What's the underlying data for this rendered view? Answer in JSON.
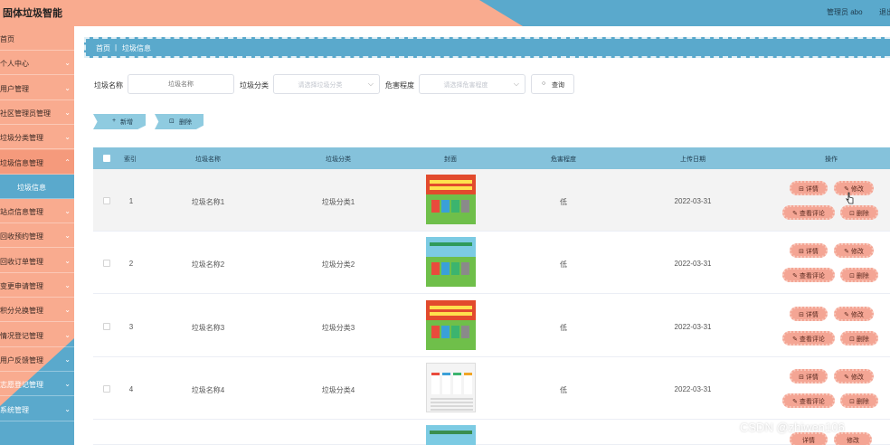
{
  "header": {
    "title": "固体垃圾智能",
    "user": "管理员 abo",
    "logout": "退出"
  },
  "sidebar": {
    "items": [
      {
        "label": "首页",
        "chevron": false
      },
      {
        "label": "个人中心",
        "chevron": true
      },
      {
        "label": "用户管理",
        "chevron": true
      },
      {
        "label": "社区管理员管理",
        "chevron": true
      },
      {
        "label": "垃圾分类管理",
        "chevron": true
      },
      {
        "label": "垃圾信息管理",
        "chevron": true,
        "open": true
      },
      {
        "label": "垃圾信息",
        "sub": true
      },
      {
        "label": "站点信息管理",
        "chevron": true
      },
      {
        "label": "回收预约管理",
        "chevron": true
      },
      {
        "label": "回收订单管理",
        "chevron": true
      },
      {
        "label": "变更申请管理",
        "chevron": true
      },
      {
        "label": "积分兑换管理",
        "chevron": true
      },
      {
        "label": "情况登记管理",
        "chevron": true
      },
      {
        "label": "用户反馈管理",
        "chevron": true
      },
      {
        "label": "志愿登记管理",
        "chevron": true
      },
      {
        "label": "系统管理",
        "chevron": true
      }
    ]
  },
  "breadcrumb": {
    "home": "首页",
    "sep": "|",
    "current": "垃圾信息"
  },
  "search": {
    "name_label": "垃圾名称",
    "name_placeholder": "垃圾名称",
    "category_label": "垃圾分类",
    "category_placeholder": "请选择垃圾分类",
    "hazard_label": "危害程度",
    "hazard_placeholder": "请选择危害程度",
    "query_button": "查询"
  },
  "actions": {
    "add": "新增",
    "delete": "删除"
  },
  "table": {
    "headers": {
      "index": "索引",
      "name": "垃圾名称",
      "category": "垃圾分类",
      "cover": "封面",
      "hazard": "危害程度",
      "upload_date": "上传日期",
      "operation": "操作"
    },
    "rows": [
      {
        "index": "1",
        "name": "垃圾名称1",
        "category": "垃圾分类1",
        "hazard": "低",
        "date": "2022-03-31"
      },
      {
        "index": "2",
        "name": "垃圾名称2",
        "category": "垃圾分类2",
        "hazard": "低",
        "date": "2022-03-31"
      },
      {
        "index": "3",
        "name": "垃圾名称3",
        "category": "垃圾分类3",
        "hazard": "低",
        "date": "2022-03-31"
      },
      {
        "index": "4",
        "name": "垃圾名称4",
        "category": "垃圾分类4",
        "hazard": "低",
        "date": "2022-03-31"
      }
    ],
    "ops": {
      "detail": "详情",
      "edit": "修改",
      "comments": "查看评论",
      "delete": "删除"
    }
  },
  "watermark": "CSDN @zhiwen106",
  "colors": {
    "blue": "#5aa9cc",
    "salmon": "#f9ab8f",
    "header_row": "#85c2db",
    "op_button": "#f4a594"
  }
}
